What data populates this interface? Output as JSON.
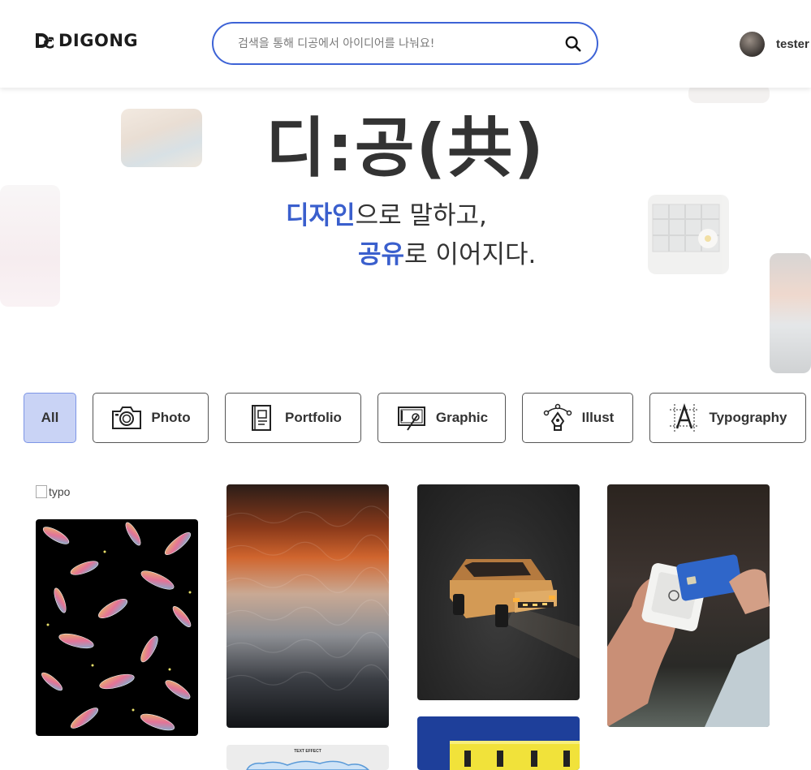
{
  "header": {
    "logo_text": "DIGONG",
    "search_placeholder": "검색을 통해 디공에서 아이디어를 나눠요!",
    "username": "tester"
  },
  "hero": {
    "title": "디:공(共)",
    "line1_accent": "디자인",
    "line1_rest": "으로 말하고,",
    "line2_accent": "공유",
    "line2_rest": "로 이어지다."
  },
  "filters": [
    {
      "label": "All",
      "icon": "none",
      "active": true
    },
    {
      "label": "Photo",
      "icon": "camera-icon",
      "active": false
    },
    {
      "label": "Portfolio",
      "icon": "book-icon",
      "active": false
    },
    {
      "label": "Graphic",
      "icon": "monitor-pen-icon",
      "active": false
    },
    {
      "label": "Illust",
      "icon": "pen-tool-icon",
      "active": false
    },
    {
      "label": "Typography",
      "icon": "type-grid-icon",
      "active": false
    }
  ],
  "gallery": {
    "broken_image_alt": "typo",
    "small_caption": "TEXT EFFECT"
  },
  "colors": {
    "accent": "#3a5fcd",
    "search_border": "#3d63d6",
    "active_chip_bg": "#c9d3f5"
  }
}
